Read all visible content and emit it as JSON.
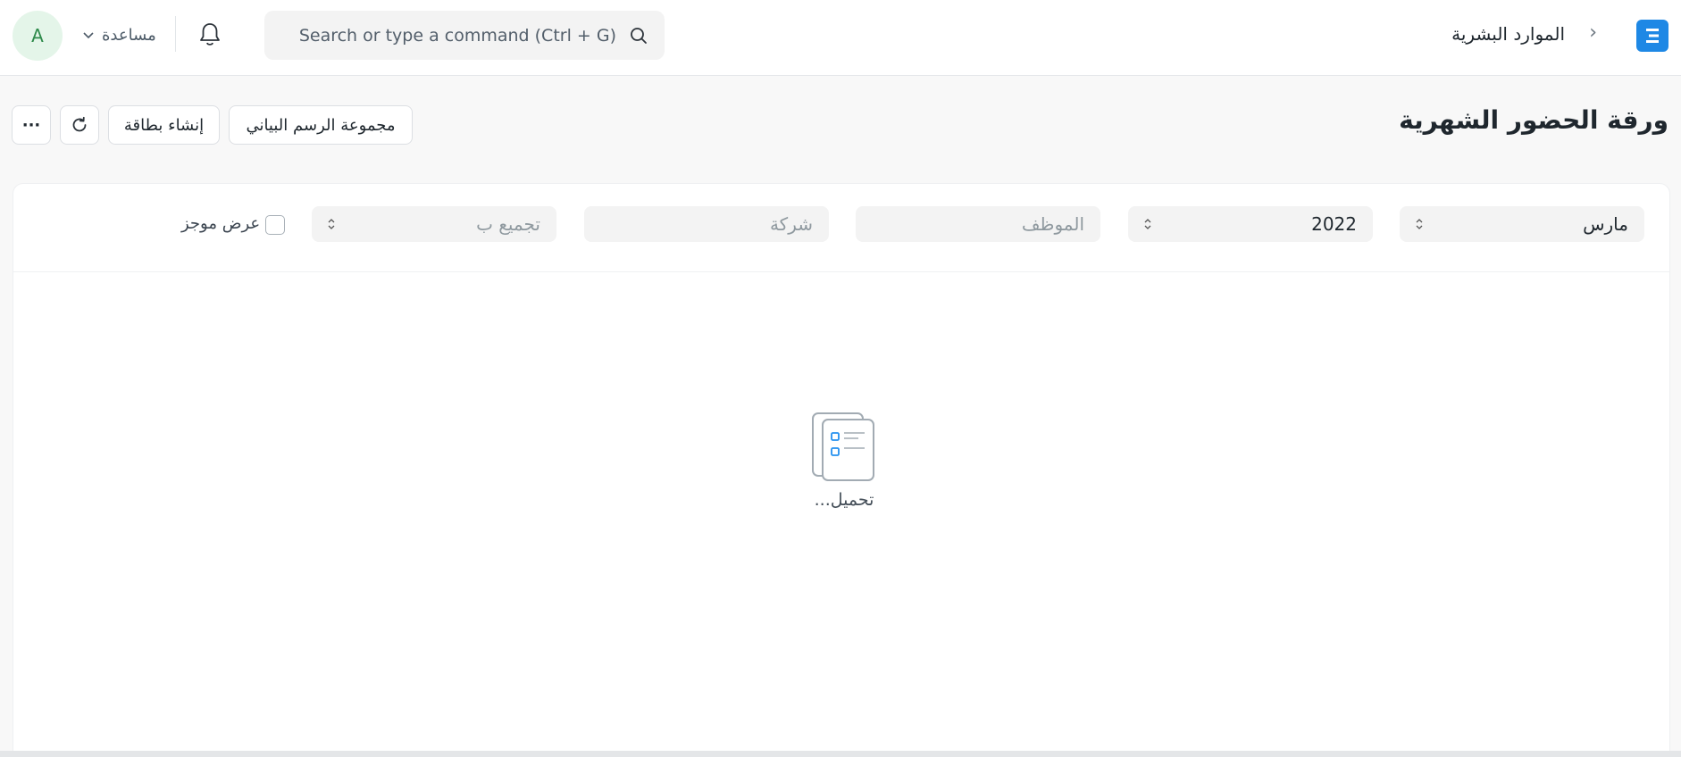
{
  "navbar": {
    "avatar_initial": "A",
    "help_label": "مساعدة",
    "search_placeholder": "Search or type a command (Ctrl + G)",
    "breadcrumb": "الموارد البشرية",
    "breadcrumb_separator": "›",
    "logo_icon": "erpnext-logo-icon",
    "accent_color": "#1e88e5"
  },
  "page": {
    "title": "ورقة الحضور الشهرية",
    "buttons": {
      "chart_group": "مجموعة الرسم البياني",
      "create_card": "إنشاء بطاقة",
      "refresh_icon": "refresh-icon",
      "more_label": "···"
    }
  },
  "filters": {
    "month": {
      "value": "مارس"
    },
    "year": {
      "value": "2022"
    },
    "employee": {
      "placeholder": "الموظف"
    },
    "company": {
      "placeholder": "شركة"
    },
    "group_by": {
      "placeholder": "تجميع ب"
    },
    "summarized_view": {
      "label": "عرض موجز",
      "checked": false
    }
  },
  "report": {
    "loading_text": "تحميل..."
  }
}
